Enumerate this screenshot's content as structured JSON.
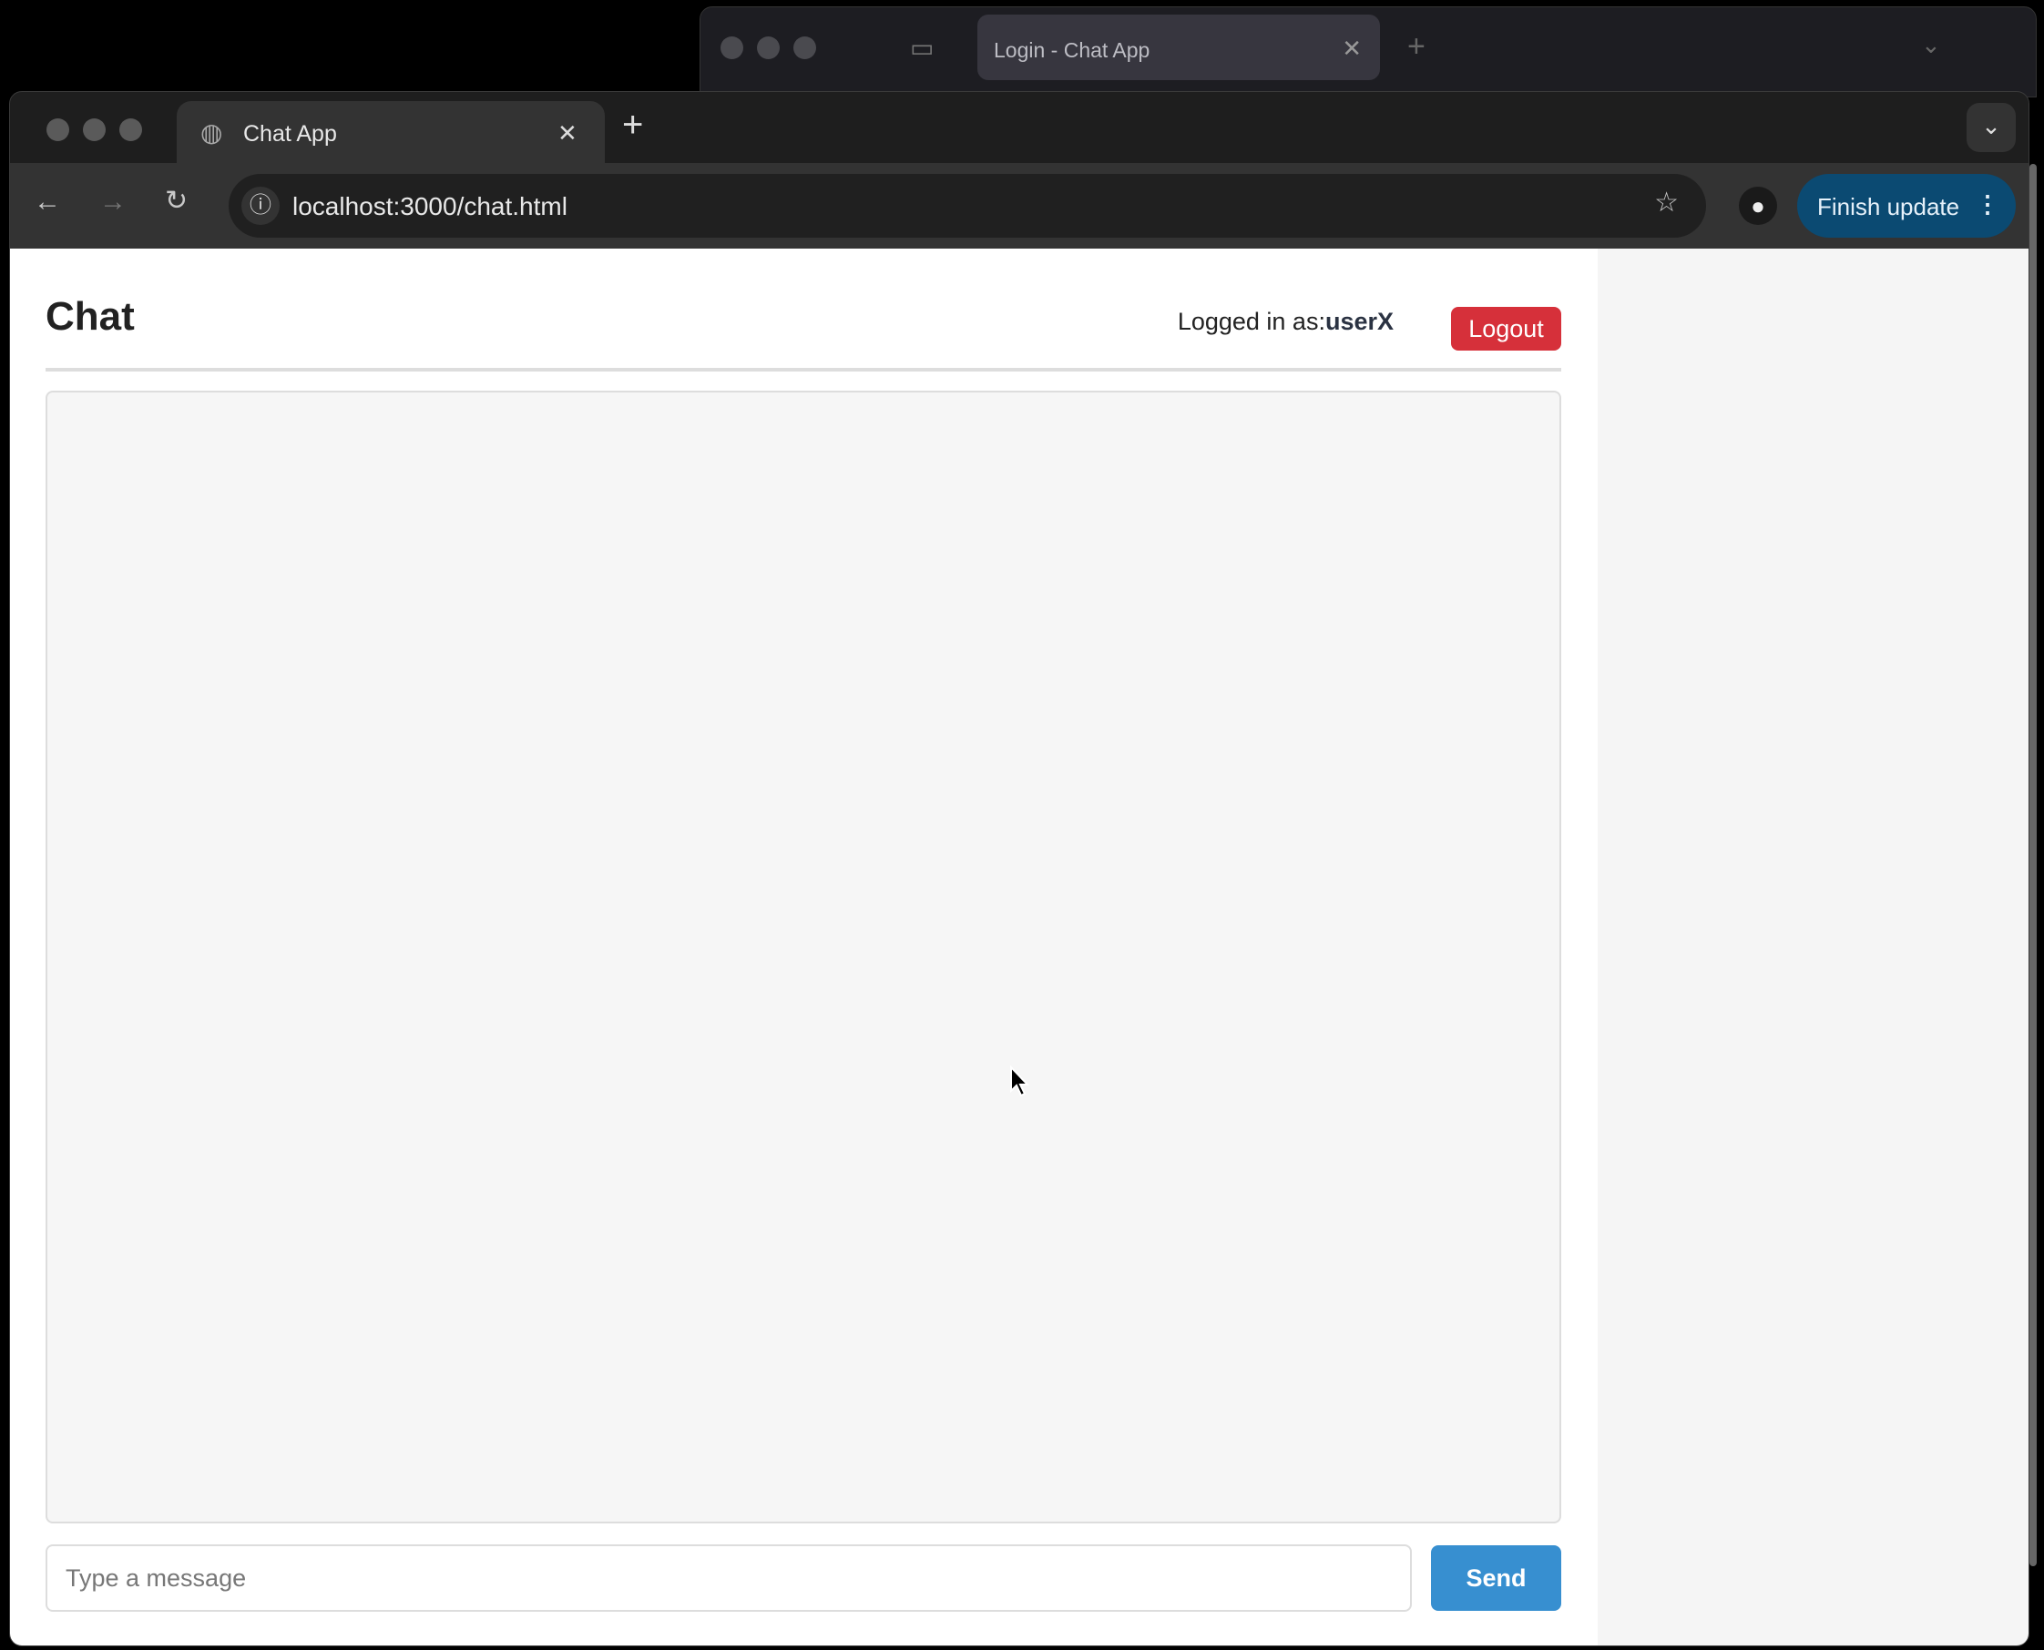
{
  "background_window": {
    "tab_title": "Login - Chat App"
  },
  "browser": {
    "tab_title": "Chat App",
    "url": "localhost:3000/chat.html",
    "finish_update": "Finish update"
  },
  "page": {
    "title": "Chat",
    "logged_in_label": "Logged in as:",
    "username": "userX",
    "logout": "Logout",
    "message_placeholder": "Type a message",
    "send": "Send",
    "messages": []
  },
  "colors": {
    "logout": "#d6303a",
    "send": "#378fd0",
    "finish_update": "#0b4a72"
  }
}
